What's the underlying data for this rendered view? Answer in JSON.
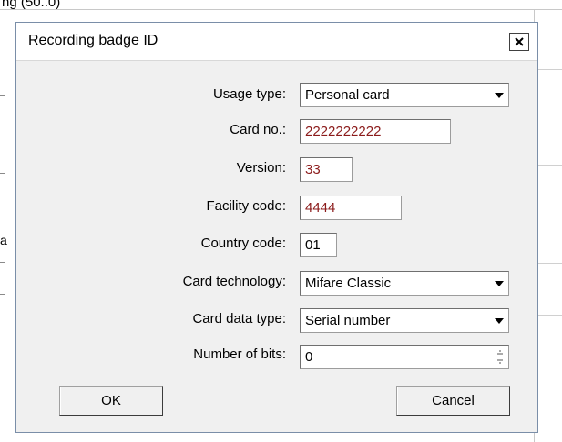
{
  "background": {
    "caption": "ng (50..0)",
    "fragment": "a"
  },
  "dialog": {
    "title": "Recording badge ID",
    "close_label": "×"
  },
  "form": {
    "usage_type": {
      "label": "Usage type:",
      "value": "Personal card"
    },
    "card_no": {
      "label": "Card no.:",
      "value": "2222222222"
    },
    "version": {
      "label": "Version:",
      "value": "33"
    },
    "facility_code": {
      "label": "Facility code:",
      "value": "4444"
    },
    "country_code": {
      "label": "Country code:",
      "value": "01"
    },
    "card_technology": {
      "label": "Card technology:",
      "value": "Mifare Classic"
    },
    "card_data_type": {
      "label": "Card data type:",
      "value": "Serial number"
    },
    "number_of_bits": {
      "label": "Number of bits:",
      "value": "0"
    }
  },
  "buttons": {
    "ok": "OK",
    "cancel": "Cancel"
  },
  "colors": {
    "value_red": "#8b1a1a",
    "dialog_bg": "#f0f0f0"
  },
  "icons": {
    "dropdown": "dropdown-arrow-icon",
    "spin": "spin-arrows-icon",
    "close": "close-icon"
  }
}
